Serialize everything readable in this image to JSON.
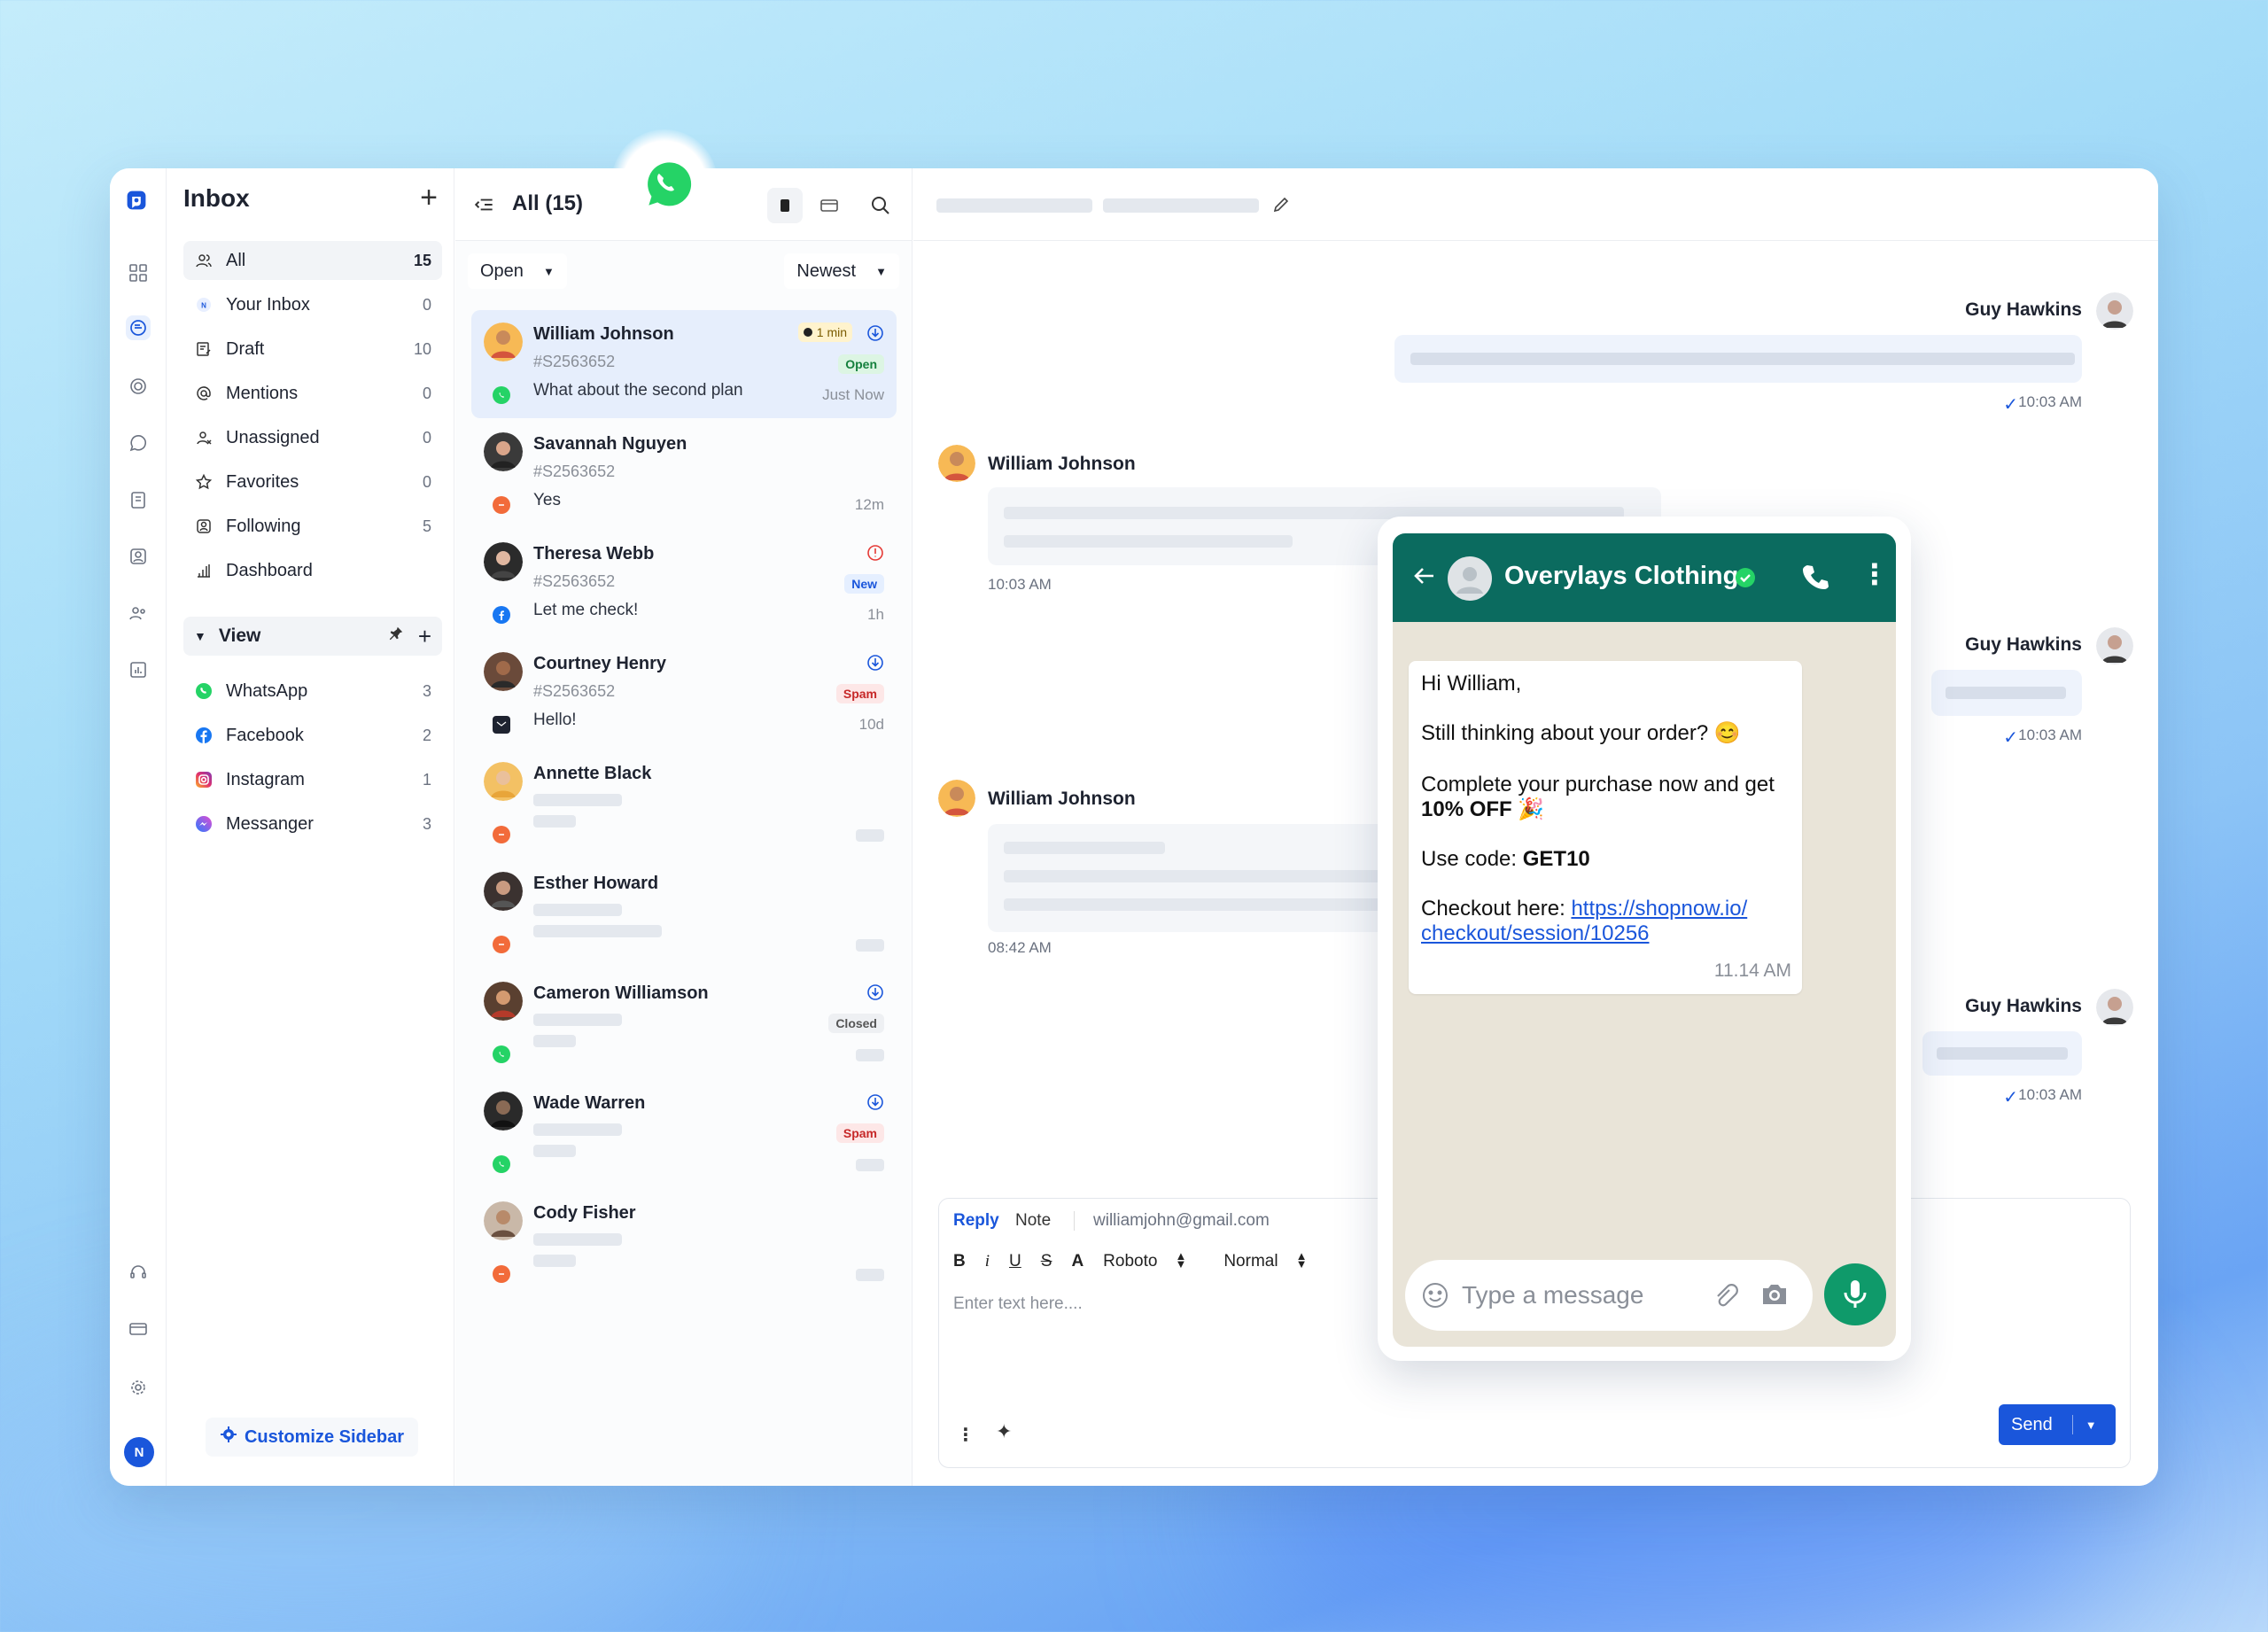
{
  "colors": {
    "accent": "#1a56db",
    "whatsapp": "#25d366",
    "wa_header": "#0b6b5f",
    "badge_open_bg": "#dcf5e3",
    "badge_new_bg": "#e5efff",
    "badge_spam_bg": "#fde7e7",
    "badge_closed_bg": "#eef0f3"
  },
  "sidebar": {
    "title": "Inbox",
    "items": [
      {
        "label": "All",
        "count": "15",
        "icon": "people-icon"
      },
      {
        "label": "Your Inbox",
        "count": "0",
        "icon": "user-badge-icon"
      },
      {
        "label": "Draft",
        "count": "10",
        "icon": "draft-icon"
      },
      {
        "label": "Mentions",
        "count": "0",
        "icon": "at-icon"
      },
      {
        "label": "Unassigned",
        "count": "0",
        "icon": "unassigned-icon"
      },
      {
        "label": "Favorites",
        "count": "0",
        "icon": "star-icon"
      },
      {
        "label": "Following",
        "count": "5",
        "icon": "following-icon"
      },
      {
        "label": "Dashboard",
        "count": "",
        "icon": "bar-chart-icon"
      }
    ],
    "view_label": "View",
    "channels": [
      {
        "label": "WhatsApp",
        "count": "3"
      },
      {
        "label": "Facebook",
        "count": "2"
      },
      {
        "label": "Instagram",
        "count": "1"
      },
      {
        "label": "Messanger",
        "count": "3"
      }
    ],
    "customize_label": "Customize Sidebar",
    "user_initial": "N"
  },
  "list": {
    "title": "All (15)",
    "filter": "Open",
    "sort": "Newest",
    "conversations": [
      {
        "name": "William Johnson",
        "id": "#S2563652",
        "message": "What about the second plan",
        "time": "Just Now",
        "tag": "Open",
        "timer": "1 min",
        "channel": "whatsapp"
      },
      {
        "name": "Savannah Nguyen",
        "id": "#S2563652",
        "message": "Yes",
        "time": "12m",
        "tag": "",
        "channel": "chat"
      },
      {
        "name": "Theresa Webb",
        "id": "#S2563652",
        "message": "Let me check!",
        "time": "1h",
        "tag": "New",
        "channel": "facebook"
      },
      {
        "name": "Courtney Henry",
        "id": "#S2563652",
        "message": "Hello!",
        "time": "10d",
        "tag": "Spam",
        "channel": "email"
      },
      {
        "name": "Annette Black",
        "channel": "chat"
      },
      {
        "name": "Esther Howard",
        "channel": "chat"
      },
      {
        "name": "Cameron Williamson",
        "tag": "Closed",
        "channel": "whatsapp"
      },
      {
        "name": "Wade Warren",
        "tag": "Spam",
        "channel": "whatsapp"
      },
      {
        "name": "Cody Fisher",
        "channel": "chat"
      }
    ]
  },
  "chat": {
    "agent_name": "Guy Hawkins",
    "customer_name": "William Johnson",
    "times": {
      "t1": "10:03 AM",
      "t2": "10:03 AM",
      "t3": "10:03 AM",
      "t4": "08:42 AM",
      "t5": "10:03 AM"
    },
    "reply": {
      "tab_reply": "Reply",
      "tab_note": "Note",
      "email": "williamjohn@gmail.com",
      "font": "Roboto",
      "size": "Normal",
      "placeholder": "Enter text here....",
      "send": "Send"
    }
  },
  "whatsapp_preview": {
    "business_name": "Overylays Clothing",
    "greeting": "Hi William,",
    "line1": "Still thinking about your order? 😊",
    "line2a": "Complete your purchase now and get",
    "line2b": "10% OFF",
    "line2c": " 🎉",
    "line3a": "Use code: ",
    "line3b": "GET10",
    "line4a": "Checkout here: ",
    "link1": "https://shopnow.io/",
    "link2": "checkout/session/10256",
    "time": "11.14 AM",
    "input_placeholder": "Type a message"
  }
}
